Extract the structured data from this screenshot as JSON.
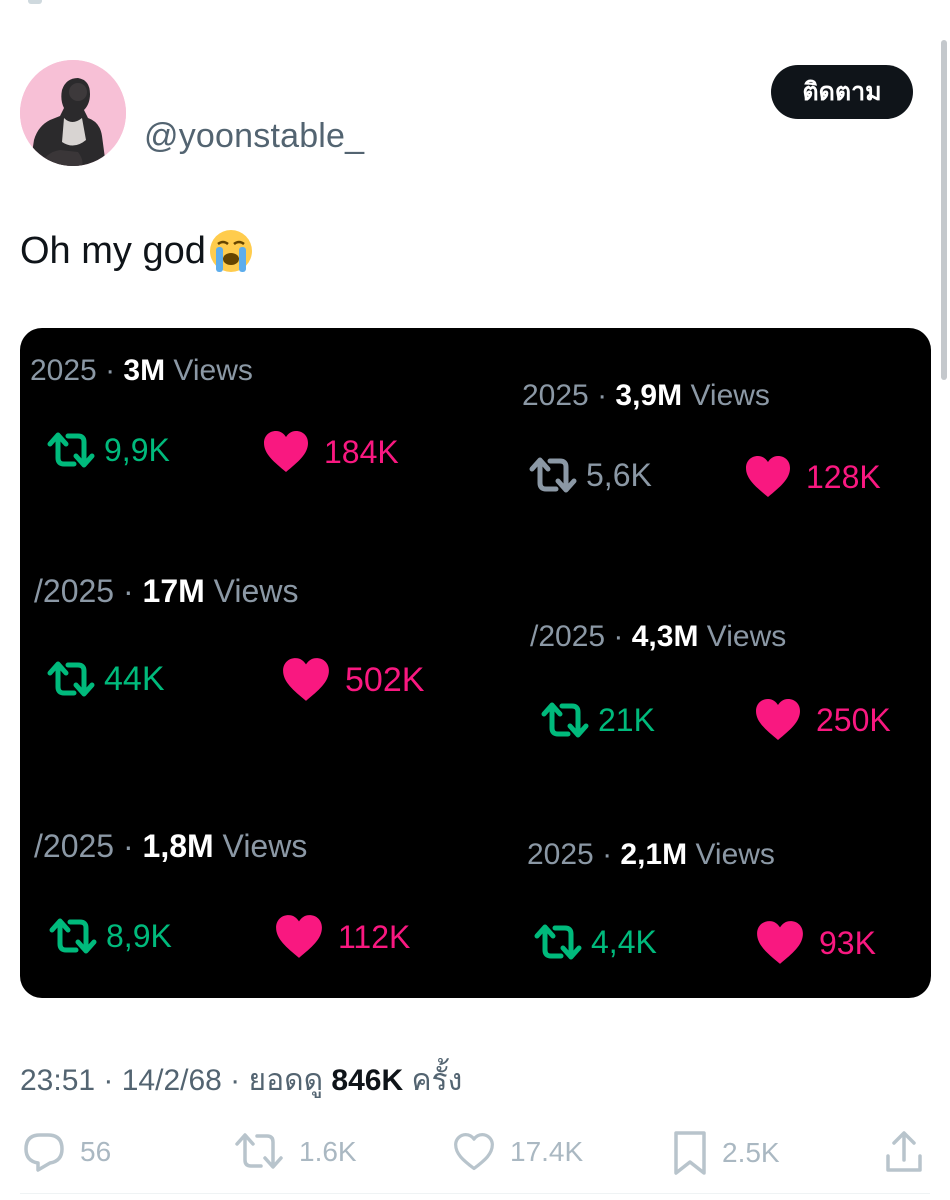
{
  "author": {
    "handle": "@yoonstable_"
  },
  "follow_button": {
    "label": "ติดตาม"
  },
  "tweet": {
    "text": "Oh my god"
  },
  "media_stats": [
    {
      "date_prefix": "2025 · ",
      "views_value": "3M",
      "views_suffix": " Views",
      "retweets": "9,9K",
      "likes": "184K"
    },
    {
      "date_prefix": "2025 · ",
      "views_value": "3,9M",
      "views_suffix": " Views",
      "retweets": "5,6K",
      "likes": "128K"
    },
    {
      "date_prefix": "/2025 · ",
      "views_value": "17M",
      "views_suffix": " Views",
      "retweets": "44K",
      "likes": "502K"
    },
    {
      "date_prefix": "/2025 · ",
      "views_value": "4,3M",
      "views_suffix": " Views",
      "retweets": "21K",
      "likes": "250K"
    },
    {
      "date_prefix": "/2025 · ",
      "views_value": "1,8M",
      "views_suffix": " Views",
      "retweets": "8,9K",
      "likes": "112K"
    },
    {
      "date_prefix": "2025 · ",
      "views_value": "2,1M",
      "views_suffix": " Views",
      "retweets": "4,4K",
      "likes": "93K"
    }
  ],
  "meta": {
    "time_date": "23:51 · 14/2/68 · ",
    "views_label": "ยอดดู ",
    "views_count": "846K",
    "views_unit": " ครั้ง"
  },
  "actions": {
    "replies": "56",
    "reposts": "1.6K",
    "likes": "17.4K",
    "bookmarks": "2.5K"
  },
  "colors": {
    "retweet_green": "#00ba7c",
    "like_pink": "#f91880",
    "follow_bg": "#0f1419"
  }
}
